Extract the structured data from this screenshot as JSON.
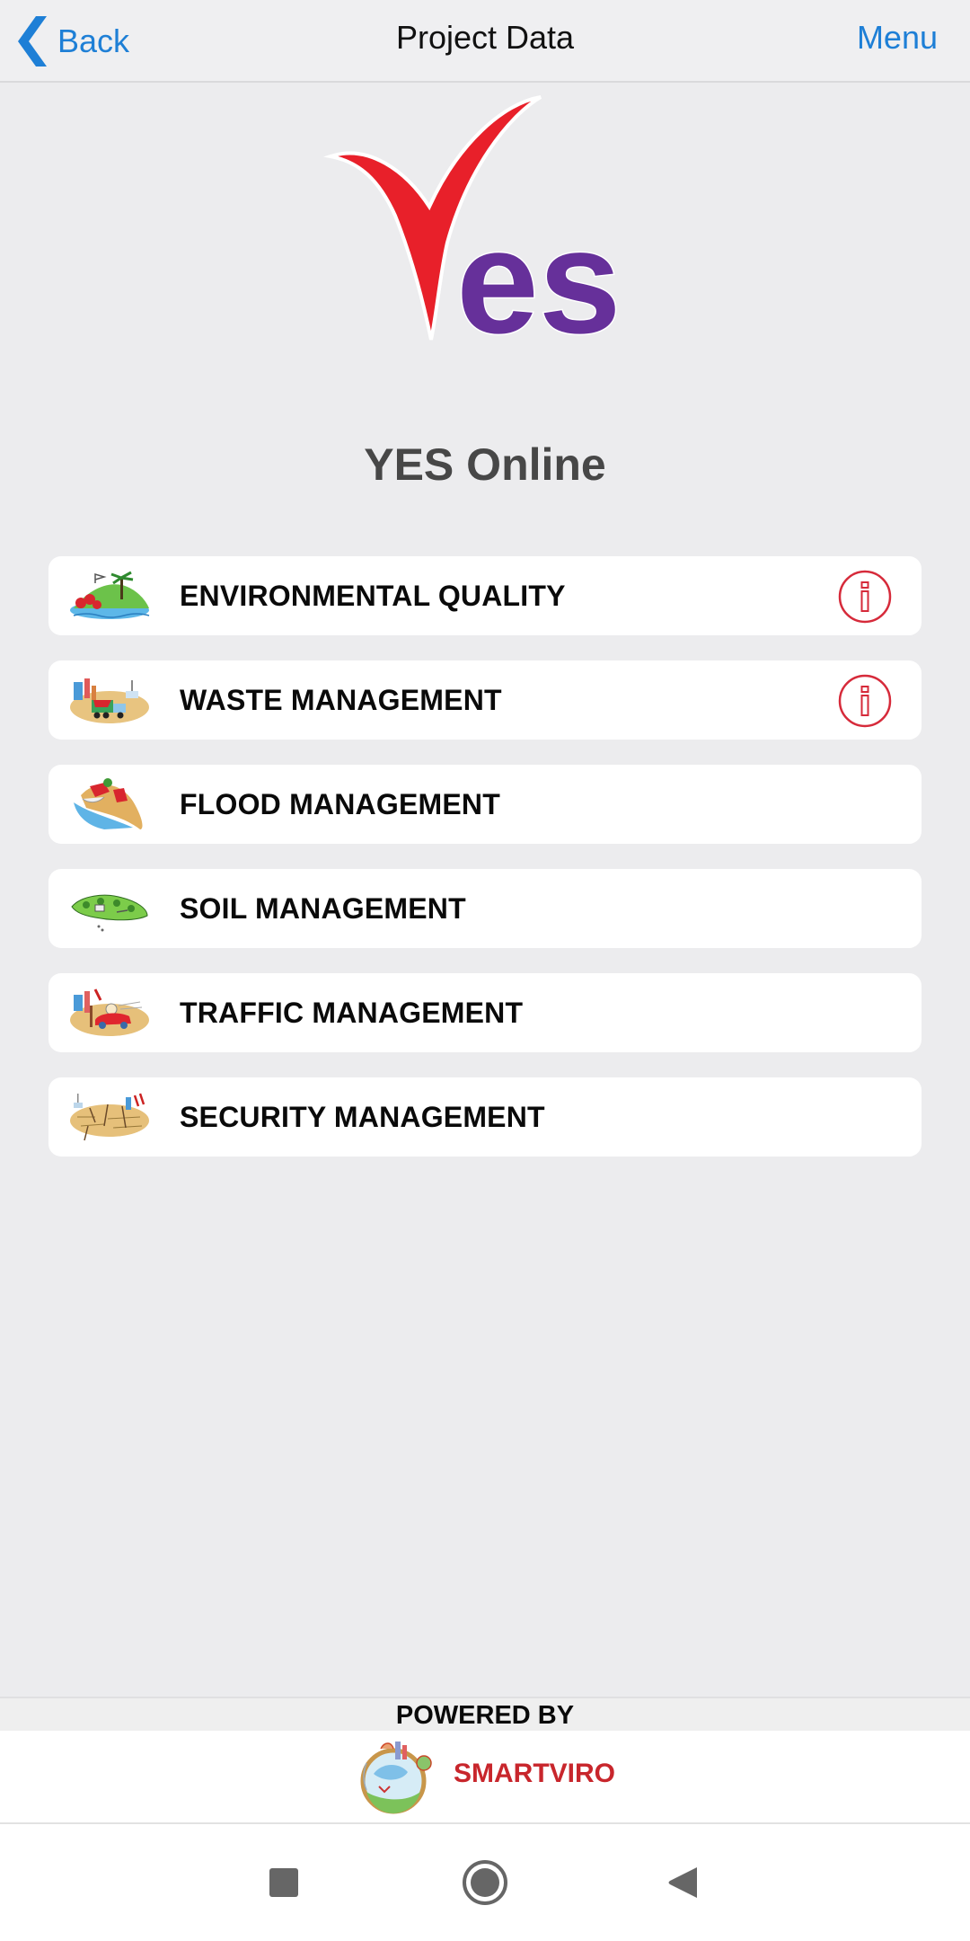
{
  "header": {
    "back_label": "Back",
    "title": "Project Data",
    "menu_label": "Menu",
    "accent_color": "#1e7fd6"
  },
  "logo": {
    "brand_text": "es",
    "check_color": "#e8202a",
    "text_color": "#66309a"
  },
  "app_title": "YES Online",
  "modules": [
    {
      "label": "ENVIRONMENTAL QUALITY",
      "icon": "environment-illustration-icon",
      "has_info": true
    },
    {
      "label": "WASTE MANAGEMENT",
      "icon": "waste-truck-illustration-icon",
      "has_info": true
    },
    {
      "label": "FLOOD MANAGEMENT",
      "icon": "flood-illustration-icon",
      "has_info": false
    },
    {
      "label": "SOIL MANAGEMENT",
      "icon": "soil-illustration-icon",
      "has_info": false
    },
    {
      "label": "TRAFFIC MANAGEMENT",
      "icon": "traffic-car-illustration-icon",
      "has_info": false
    },
    {
      "label": "SECURITY MANAGEMENT",
      "icon": "security-illustration-icon",
      "has_info": false
    }
  ],
  "info_icon_color": "#d62a3a",
  "footer": {
    "powered_by": "POWERED BY",
    "brand_name": "SMARTVIRO",
    "brand_color": "#c8262c"
  },
  "system_nav": {
    "recents": "recents-square-icon",
    "home": "home-circle-icon",
    "back": "back-triangle-icon"
  }
}
